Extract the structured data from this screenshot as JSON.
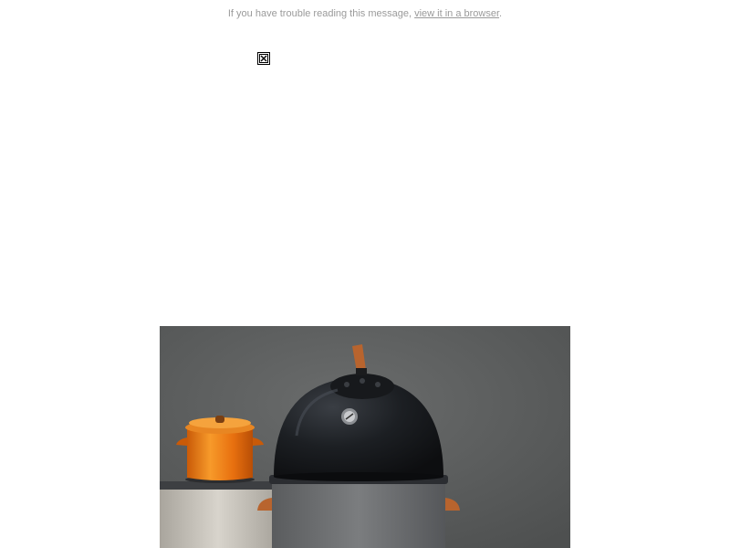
{
  "preheader": {
    "message": "If you have trouble reading this message, ",
    "link_text": "view it in a browser",
    "suffix": "."
  },
  "logo_image": {
    "icon": "broken-image-icon"
  },
  "hero_image": {
    "icon": "cookware-photo",
    "colors": {
      "backdrop": "#5c5e5e",
      "pot": "#f07a13",
      "dome": "#1a1c1f",
      "concrete": "#c9c5bd",
      "accent": "#b8642e"
    }
  }
}
